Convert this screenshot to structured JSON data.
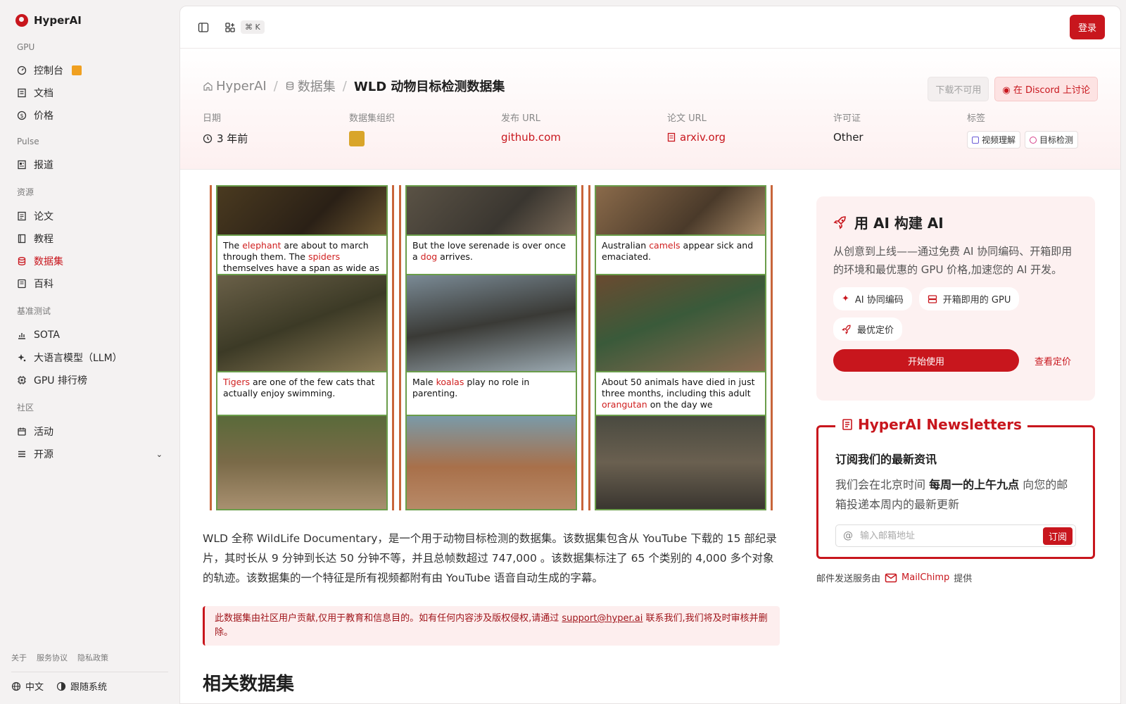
{
  "brand": {
    "name": "HyperAI"
  },
  "sidebar": {
    "sections": [
      {
        "title": "GPU",
        "items": [
          {
            "label": "控制台"
          },
          {
            "label": "文档"
          },
          {
            "label": "价格"
          }
        ]
      },
      {
        "title": "Pulse",
        "items": [
          {
            "label": "报道"
          }
        ]
      },
      {
        "title": "资源",
        "items": [
          {
            "label": "论文"
          },
          {
            "label": "教程"
          },
          {
            "label": "数据集"
          },
          {
            "label": "百科"
          }
        ]
      },
      {
        "title": "基准测试",
        "items": [
          {
            "label": "SOTA"
          },
          {
            "label": "大语言模型（LLM）"
          },
          {
            "label": "GPU 排行榜"
          }
        ]
      },
      {
        "title": "社区",
        "items": [
          {
            "label": "活动"
          },
          {
            "label": "开源"
          }
        ]
      }
    ],
    "footer_links": [
      "关于",
      "服务协议",
      "隐私政策"
    ],
    "language": "中文",
    "theme": "跟随系统"
  },
  "topbar": {
    "shortcut": "⌘ K",
    "login": "登录"
  },
  "breadcrumb": {
    "home": "HyperAI",
    "section": "数据集",
    "current": "WLD 动物目标检测数据集"
  },
  "actions": {
    "download": "下载不可用",
    "discord": "在 Discord 上讨论"
  },
  "meta": {
    "date_label": "日期",
    "date_value": "3 年前",
    "org_label": "数据集组织",
    "release_label": "发布 URL",
    "release_value": "github.com",
    "paper_label": "论文 URL",
    "paper_value": "arxiv.org",
    "license_label": "许可证",
    "license_value": "Other",
    "tags_label": "标签",
    "tags": [
      "视频理解",
      "目标检测"
    ]
  },
  "figure": {
    "captions": [
      {
        "pre": "The ",
        "hl": "elephant",
        "mid": " are about to march through them. The ",
        "hl2": "spiders",
        "post": " themselves have a span as wide as a"
      },
      {
        "pre": "But the love serenade is over once a ",
        "hl": "dog",
        "post": " arrives."
      },
      {
        "pre": "Australian ",
        "hl": "camels",
        "post": " appear sick and emaciated."
      },
      {
        "pre": "",
        "hl": "Tigers",
        "post": " are one of the few cats that actually enjoy swimming."
      },
      {
        "pre": "Male ",
        "hl": "koalas",
        "post": " play no role in parenting."
      },
      {
        "pre": "About 50 animals have died in just three months, including this adult ",
        "hl": "orangutan",
        "post": " on the day we"
      }
    ]
  },
  "description": "WLD 全称 WildLife Documentary，是一个用于动物目标检测的数据集。该数据集包含从 YouTube 下载的 15 部纪录片，其时长从 9 分钟到长达 50 分钟不等，并且总帧数超过 747,000 。该数据集标注了 65 个类别的 4,000 多个对象的轨迹。该数据集的一个特征是所有视频都附有由 YouTube 语音自动生成的字幕。",
  "notice": {
    "pre": "此数据集由社区用户贡献,仅用于教育和信息目的。如有任何内容涉及版权侵权,请通过 ",
    "email": "support@hyper.ai",
    "post": " 联系我们,我们将及时审核并删除。"
  },
  "related_title": "相关数据集",
  "promo": {
    "title": "用 AI 构建 AI",
    "text": "从创意到上线——通过免费 AI 协同编码、开箱即用的环境和最优惠的 GPU 价格,加速您的 AI 开发。",
    "chips": [
      "AI 协同编码",
      "开箱即用的 GPU",
      "最优定价"
    ],
    "start": "开始使用",
    "pricing": "查看定价"
  },
  "newsletter": {
    "title": "HyperAI Newsletters",
    "heading": "订阅我们的最新资讯",
    "text_pre": "我们会在北京时间 ",
    "text_bold": "每周一的上午九点",
    "text_post": " 向您的邮箱投递本周内的最新更新",
    "placeholder": "输入邮箱地址",
    "subscribe": "订阅",
    "provider_pre": "邮件发送服务由",
    "provider_name": "MailChimp",
    "provider_post": "提供"
  },
  "colors": {
    "accent": "#c8161d",
    "sidebar_bg": "#f4f2f2",
    "tag_video": "#6b5bd6",
    "tag_detect": "#d6408a"
  }
}
